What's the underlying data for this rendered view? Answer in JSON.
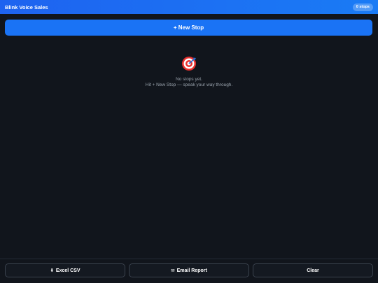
{
  "header": {
    "title": "Blink Voice Sales",
    "stops_badge": "0 stops"
  },
  "actions": {
    "new_stop_label": "+ New Stop"
  },
  "empty_state": {
    "icon": "target-icon",
    "line1": "No stops yet.",
    "line2": "Hit + New Stop — speak your way through."
  },
  "footer": {
    "csv_icon": "⬇",
    "csv_label": "Excel CSV",
    "email_icon": "✉",
    "email_label": "Email Report",
    "clear_label": "Clear"
  },
  "colors": {
    "accent": "#1a73f5",
    "background": "#11151c"
  }
}
